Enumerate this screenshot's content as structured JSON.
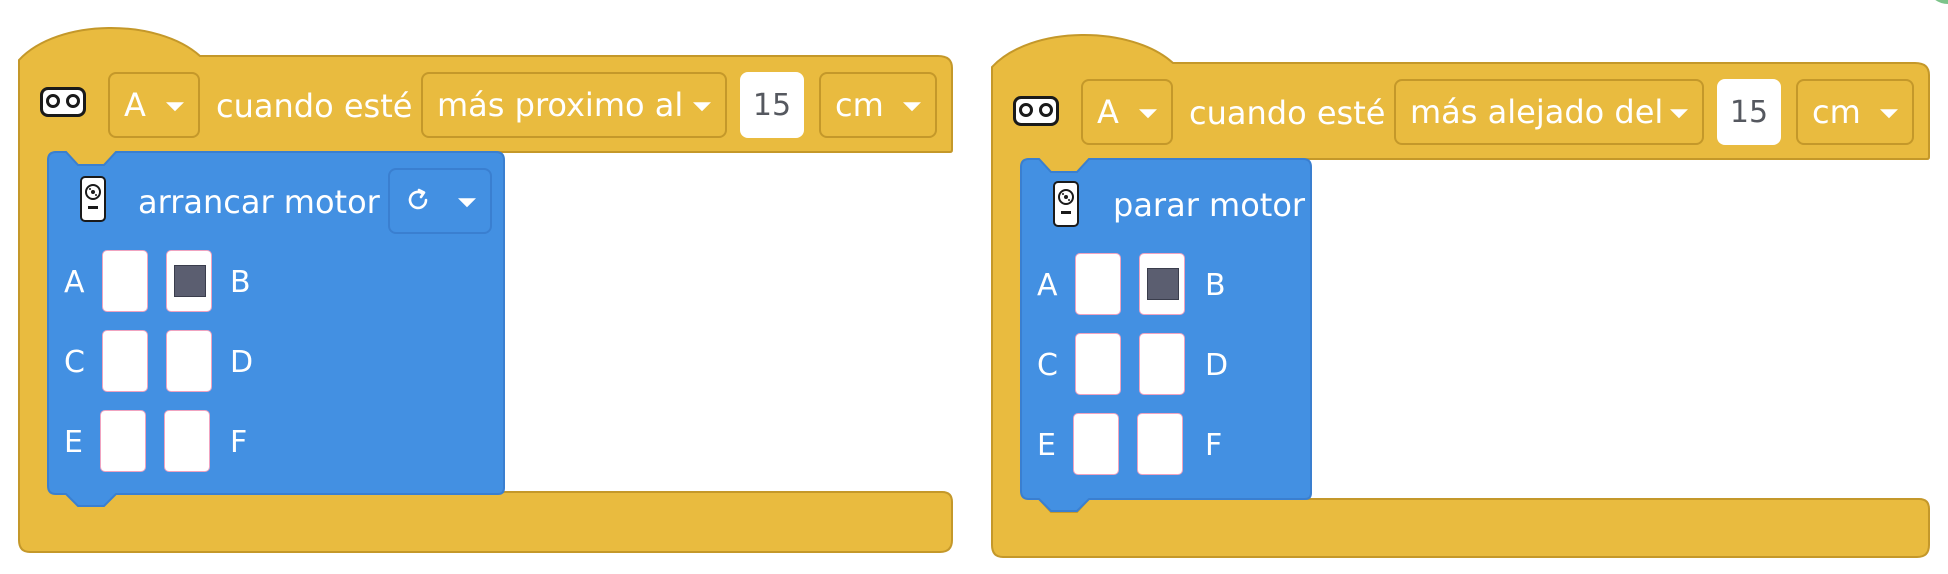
{
  "blocks": [
    {
      "hat": {
        "sensor_icon": "distance-sensor-icon",
        "port_value": "A",
        "label": "cuando esté",
        "comparison_value": "más proximo al",
        "distance_value": "15",
        "unit_value": "cm"
      },
      "inner": {
        "motor_icon": "motor-icon",
        "label": "arrancar motor",
        "direction_icon": "rotate-clockwise-icon",
        "ports": [
          {
            "label": "A",
            "selected": false
          },
          {
            "label": "B",
            "selected": true
          },
          {
            "label": "C",
            "selected": false
          },
          {
            "label": "D",
            "selected": false
          },
          {
            "label": "E",
            "selected": false
          },
          {
            "label": "F",
            "selected": false
          }
        ]
      }
    },
    {
      "hat": {
        "sensor_icon": "distance-sensor-icon",
        "port_value": "A",
        "label": "cuando esté",
        "comparison_value": "más alejado del",
        "distance_value": "15",
        "unit_value": "cm"
      },
      "inner": {
        "motor_icon": "motor-icon",
        "label": "parar motor",
        "ports": [
          {
            "label": "A",
            "selected": false
          },
          {
            "label": "B",
            "selected": true
          },
          {
            "label": "C",
            "selected": false
          },
          {
            "label": "D",
            "selected": false
          },
          {
            "label": "E",
            "selected": false
          },
          {
            "label": "F",
            "selected": false
          }
        ]
      }
    }
  ],
  "colors": {
    "event_block": "#e9bb3f",
    "event_border": "#c4982a",
    "motor_block": "#4390e2",
    "motor_border": "#3a7fd0",
    "selected_port": "#5b5e70"
  }
}
